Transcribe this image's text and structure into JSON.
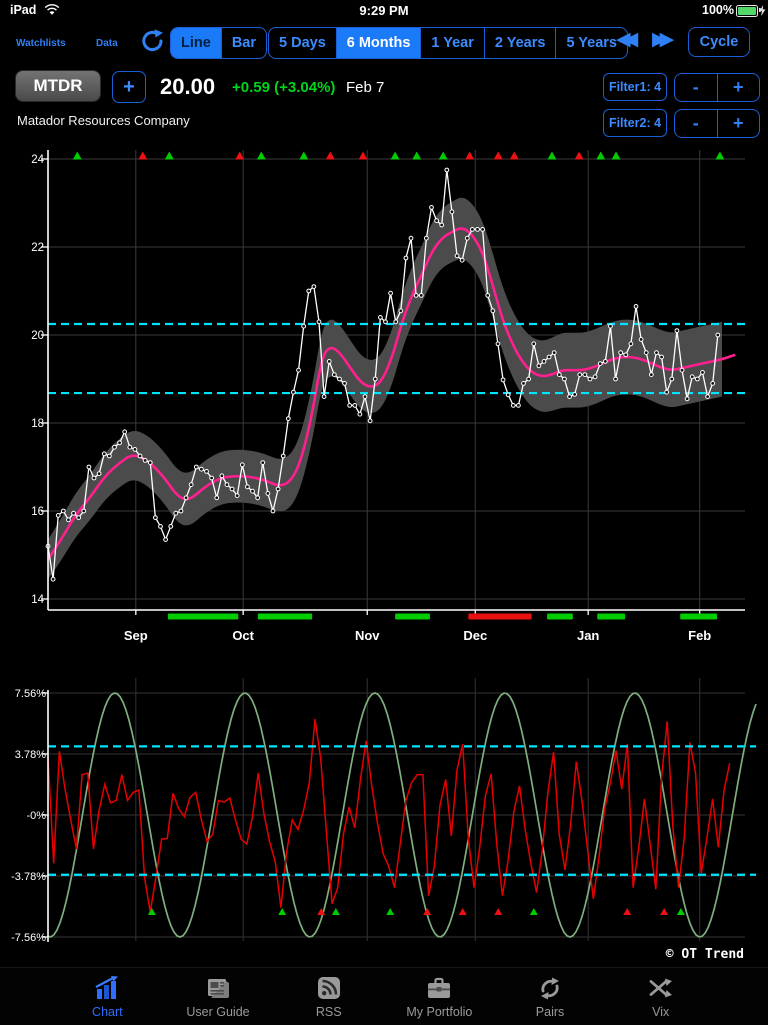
{
  "status_bar": {
    "device": "iPad",
    "time": "9:29 PM",
    "battery": "100%"
  },
  "toolbar": {
    "watchlists": "Watchlists",
    "data": "Data",
    "chart_type": [
      {
        "label": "Line",
        "selected": true
      },
      {
        "label": "Bar",
        "selected": false
      }
    ],
    "periods": [
      {
        "label": "5 Days",
        "selected": false
      },
      {
        "label": "6 Months",
        "selected": true
      },
      {
        "label": "1 Year",
        "selected": false
      },
      {
        "label": "2 Years",
        "selected": false
      },
      {
        "label": "5 Years",
        "selected": false
      }
    ],
    "cycle": "Cycle"
  },
  "ticker": {
    "symbol": "MTDR",
    "add_label": "+",
    "price": "20.00",
    "change": "+0.59 (+3.04%)",
    "date": "Feb 7",
    "company": "Matador Resources Company",
    "filter1": "Filter1: 4",
    "filter2": "Filter2: 4",
    "minus": "-",
    "plus": "+"
  },
  "watermark": "© OT Trend",
  "colors": {
    "accent": "#2f80f5",
    "selected_fill": "#1a7af8",
    "price": "#ffffff",
    "trend": "#ff1f8f",
    "band": "#4b4b4b",
    "threshold": "#00e5ff",
    "oscillator": "#e60000",
    "cycle_wave": "#7fae7f",
    "signal_up": "#00cc00",
    "signal_down": "#ee1111",
    "gain": "#00d41c",
    "grid": "#3a3a3a"
  },
  "chart_data": [
    {
      "type": "line",
      "title": "MTDR 6-month daily price with trend and channel band",
      "y_ticks": [
        24,
        22,
        20,
        18,
        16,
        14
      ],
      "ylim": [
        13.75,
        24.2
      ],
      "x_labels": [
        "Sep",
        "Oct",
        "Nov",
        "Dec",
        "Jan",
        "Feb"
      ],
      "x_label_frac": [
        0.126,
        0.28,
        0.458,
        0.613,
        0.775,
        0.935
      ],
      "thresholds": [
        20.25,
        18.68
      ],
      "grid": true,
      "series": [
        {
          "name": "price",
          "type": "line_markers",
          "x_end_frac": 0.961,
          "values": [
            15.2,
            14.45,
            15.9,
            16.0,
            15.8,
            15.95,
            15.85,
            16.0,
            17.0,
            16.75,
            16.85,
            17.3,
            17.25,
            17.45,
            17.55,
            17.8,
            17.45,
            17.4,
            17.25,
            17.15,
            17.1,
            15.85,
            15.65,
            15.35,
            15.65,
            15.95,
            16.0,
            16.3,
            16.6,
            17.0,
            16.95,
            16.9,
            16.75,
            16.3,
            16.8,
            16.6,
            16.5,
            16.35,
            17.05,
            16.55,
            16.45,
            16.3,
            17.1,
            16.4,
            16.0,
            16.5,
            17.25,
            18.1,
            18.7,
            19.2,
            20.2,
            21.0,
            21.1,
            20.3,
            18.6,
            19.4,
            19.1,
            19.0,
            18.9,
            18.4,
            18.4,
            18.2,
            18.6,
            18.05,
            19.0,
            20.4,
            20.3,
            20.95,
            20.3,
            20.55,
            21.75,
            22.2,
            20.9,
            20.9,
            22.2,
            22.9,
            22.6,
            22.5,
            23.75,
            22.8,
            21.8,
            21.7,
            22.2,
            22.4,
            22.4,
            22.4,
            20.9,
            20.55,
            19.8,
            18.98,
            18.64,
            18.4,
            18.4,
            18.9,
            19.0,
            19.8,
            19.3,
            19.4,
            19.5,
            19.6,
            19.1,
            19.0,
            18.6,
            18.65,
            19.1,
            19.1,
            19.0,
            19.05,
            19.35,
            19.4,
            20.2,
            19.0,
            19.6,
            19.55,
            19.8,
            20.65,
            19.9,
            19.6,
            19.1,
            19.6,
            19.5,
            18.7,
            19.0,
            20.1,
            19.2,
            18.55,
            19.05,
            19.0,
            19.15,
            18.6,
            18.9,
            20.0
          ]
        },
        {
          "name": "trend",
          "type": "smooth_line",
          "points": [
            [
              0.0,
              14.9
            ],
            [
              0.017,
              15.3
            ],
            [
              0.039,
              15.9
            ],
            [
              0.06,
              16.3
            ],
            [
              0.082,
              16.8
            ],
            [
              0.103,
              17.1
            ],
            [
              0.122,
              17.3
            ],
            [
              0.143,
              17.15
            ],
            [
              0.165,
              16.8
            ],
            [
              0.187,
              16.3
            ],
            [
              0.204,
              16.25
            ],
            [
              0.225,
              16.55
            ],
            [
              0.247,
              16.75
            ],
            [
              0.268,
              16.8
            ],
            [
              0.29,
              16.78
            ],
            [
              0.311,
              16.7
            ],
            [
              0.333,
              16.55
            ],
            [
              0.35,
              16.7
            ],
            [
              0.364,
              17.2
            ],
            [
              0.379,
              18.2
            ],
            [
              0.393,
              19.5
            ],
            [
              0.405,
              19.75
            ],
            [
              0.419,
              19.6
            ],
            [
              0.436,
              19.2
            ],
            [
              0.45,
              18.9
            ],
            [
              0.465,
              18.8
            ],
            [
              0.479,
              18.95
            ],
            [
              0.494,
              19.5
            ],
            [
              0.508,
              20.3
            ],
            [
              0.522,
              20.9
            ],
            [
              0.537,
              21.4
            ],
            [
              0.551,
              21.9
            ],
            [
              0.565,
              22.2
            ],
            [
              0.58,
              22.35
            ],
            [
              0.594,
              22.45
            ],
            [
              0.608,
              22.3
            ],
            [
              0.623,
              21.9
            ],
            [
              0.637,
              21.2
            ],
            [
              0.651,
              20.4
            ],
            [
              0.666,
              19.8
            ],
            [
              0.68,
              19.4
            ],
            [
              0.694,
              19.15
            ],
            [
              0.709,
              19.05
            ],
            [
              0.723,
              19.1
            ],
            [
              0.737,
              19.2
            ],
            [
              0.752,
              19.2
            ],
            [
              0.766,
              19.2
            ],
            [
              0.78,
              19.25
            ],
            [
              0.795,
              19.35
            ],
            [
              0.809,
              19.45
            ],
            [
              0.823,
              19.5
            ],
            [
              0.838,
              19.5
            ],
            [
              0.852,
              19.45
            ],
            [
              0.867,
              19.35
            ],
            [
              0.881,
              19.25
            ],
            [
              0.895,
              19.2
            ],
            [
              0.91,
              19.25
            ],
            [
              0.924,
              19.3
            ],
            [
              0.938,
              19.35
            ],
            [
              0.953,
              19.4
            ],
            [
              0.967,
              19.45
            ],
            [
              0.986,
              19.55
            ]
          ]
        },
        {
          "name": "band",
          "type": "channel",
          "halfwidth": [
            [
              0.0,
              0.45
            ],
            [
              0.04,
              0.5
            ],
            [
              0.103,
              0.55
            ],
            [
              0.19,
              0.6
            ],
            [
              0.29,
              0.6
            ],
            [
              0.36,
              0.6
            ],
            [
              0.405,
              0.65
            ],
            [
              0.465,
              0.6
            ],
            [
              0.537,
              0.65
            ],
            [
              0.594,
              0.7
            ],
            [
              0.666,
              0.75
            ],
            [
              0.737,
              0.85
            ],
            [
              0.809,
              0.85
            ],
            [
              0.895,
              0.85
            ],
            [
              0.967,
              0.85
            ]
          ],
          "x_end_frac": 0.967
        }
      ],
      "signal_triangles": [
        [
          0.042,
          "green"
        ],
        [
          0.136,
          "red"
        ],
        [
          0.174,
          "green"
        ],
        [
          0.275,
          "red"
        ],
        [
          0.306,
          "green"
        ],
        [
          0.367,
          "green"
        ],
        [
          0.405,
          "red"
        ],
        [
          0.452,
          "red"
        ],
        [
          0.498,
          "green"
        ],
        [
          0.529,
          "green"
        ],
        [
          0.567,
          "green"
        ],
        [
          0.605,
          "red"
        ],
        [
          0.646,
          "red"
        ],
        [
          0.669,
          "red"
        ],
        [
          0.723,
          "green"
        ],
        [
          0.762,
          "red"
        ],
        [
          0.793,
          "green"
        ],
        [
          0.815,
          "green"
        ],
        [
          0.964,
          "green"
        ]
      ],
      "signal_bars": [
        [
          0.172,
          0.273,
          "green"
        ],
        [
          0.301,
          0.379,
          "green"
        ],
        [
          0.498,
          0.548,
          "green"
        ],
        [
          0.603,
          0.694,
          "red"
        ],
        [
          0.716,
          0.753,
          "green"
        ],
        [
          0.788,
          0.828,
          "green"
        ],
        [
          0.907,
          0.96,
          "green"
        ]
      ]
    },
    {
      "type": "line",
      "title": "Oscillator with dominant cycle wave",
      "y_tick_labels": [
        "7.56%",
        "3.78%",
        "-0%",
        "-3.78%",
        "-7.56%"
      ],
      "y_tick_values": [
        7.56,
        3.78,
        0,
        -3.78,
        -7.56
      ],
      "thresholds": [
        4.25,
        -3.7
      ],
      "grid": true,
      "series": [
        {
          "name": "oscillator",
          "type": "line",
          "x_end_frac": 0.978,
          "values": [
            3.6,
            -3.0,
            3.95,
            1.6,
            -0.3,
            -2.1,
            2.5,
            2.6,
            -2.1,
            0.3,
            1.9,
            0.75,
            0.9,
            2.5,
            0.9,
            1.4,
            1.55,
            -3.9,
            -6.0,
            -3.85,
            -1.5,
            -1.45,
            1.35,
            0.4,
            -0.1,
            1.1,
            1.4,
            -0.3,
            -1.65,
            -1.2,
            0.9,
            0.8,
            1.05,
            -0.3,
            -1.5,
            -1.8,
            -0.1,
            2.6,
            0.1,
            -1.65,
            -2.9,
            -5.75,
            -2.3,
            -0.3,
            -0.9,
            0.3,
            2.0,
            5.95,
            3.5,
            -1.0,
            -5.5,
            -4.5,
            -1.2,
            0.5,
            -0.8,
            2.2,
            4.6,
            1.8,
            -0.5,
            -2.4,
            -3.2,
            -4.5,
            -1.8,
            0.9,
            2.0,
            2.5,
            2.5,
            -5.0,
            -3.2,
            0.6,
            2.2,
            -1.3,
            2.8,
            4.4,
            -1.5,
            -4.5,
            -2.0,
            1.2,
            2.55,
            -1.8,
            -5.0,
            -2.8,
            0.2,
            1.8,
            -0.9,
            -3.0,
            -4.8,
            -2.2,
            1.4,
            3.9,
            -1.2,
            -3.4,
            -0.6,
            3.3,
            0.9,
            -2.2,
            -5.2,
            -2.6,
            0.4,
            2.0,
            4.0,
            1.6,
            4.4,
            -4.5,
            -2.0,
            1.0,
            -1.8,
            -4.6,
            2.3,
            5.8,
            -0.7,
            -4.5,
            -1.4,
            4.5,
            2.6,
            -3.6,
            -1.4,
            1.0,
            -2.0,
            1.5,
            3.2
          ]
        },
        {
          "name": "cycle-wave",
          "type": "cosine",
          "amplitude": 7.56,
          "peak_frac": 0.096,
          "period_frac": 0.1865
        }
      ],
      "signal_triangles": [
        [
          0.149,
          "green"
        ],
        [
          0.336,
          "green"
        ],
        [
          0.392,
          "red"
        ],
        [
          0.413,
          "green"
        ],
        [
          0.491,
          "green"
        ],
        [
          0.544,
          "red"
        ],
        [
          0.595,
          "red"
        ],
        [
          0.646,
          "red"
        ],
        [
          0.697,
          "green"
        ],
        [
          0.831,
          "red"
        ],
        [
          0.884,
          "red"
        ],
        [
          0.908,
          "green"
        ]
      ]
    }
  ],
  "tab_bar": {
    "tabs": [
      {
        "label": "Chart",
        "selected": true
      },
      {
        "label": "User Guide",
        "selected": false
      },
      {
        "label": "RSS",
        "selected": false
      },
      {
        "label": "My Portfolio",
        "selected": false
      },
      {
        "label": "Pairs",
        "selected": false
      },
      {
        "label": "Vix",
        "selected": false
      }
    ]
  }
}
